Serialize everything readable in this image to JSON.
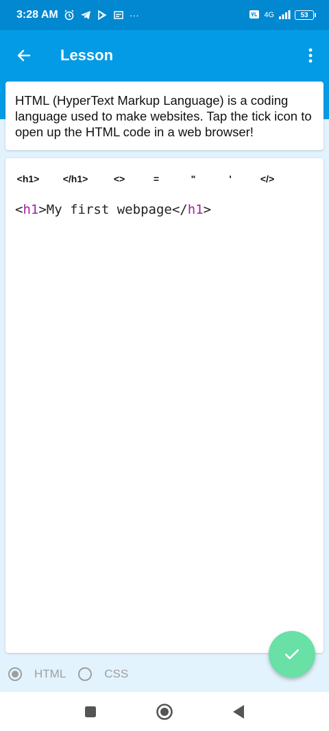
{
  "status_bar": {
    "time": "3:28 AM",
    "network": "4G",
    "battery": "53",
    "more": "···"
  },
  "app_bar": {
    "title": "Lesson"
  },
  "lesson": {
    "description": "HTML (HyperText Markup Language) is a coding language used to make websites. Tap the tick icon to open up the HTML code in a web browser!"
  },
  "editor": {
    "symbols": [
      "<h1>",
      "</h1>",
      "<>",
      "=",
      "\"",
      "'",
      "</>"
    ],
    "code": {
      "open_bracket": "<",
      "open_tag": "h1",
      "open_close": ">",
      "text": "My first webpage",
      "close_bracket": "</",
      "close_tag": "h1",
      "close_end": ">"
    }
  },
  "mode_selector": {
    "options": [
      {
        "label": "HTML",
        "selected": true
      },
      {
        "label": "CSS",
        "selected": false
      }
    ]
  },
  "colors": {
    "status_bar": "#0288d1",
    "app_bar": "#039be5",
    "fab": "#69e0a6",
    "tag": "#a020a0"
  }
}
